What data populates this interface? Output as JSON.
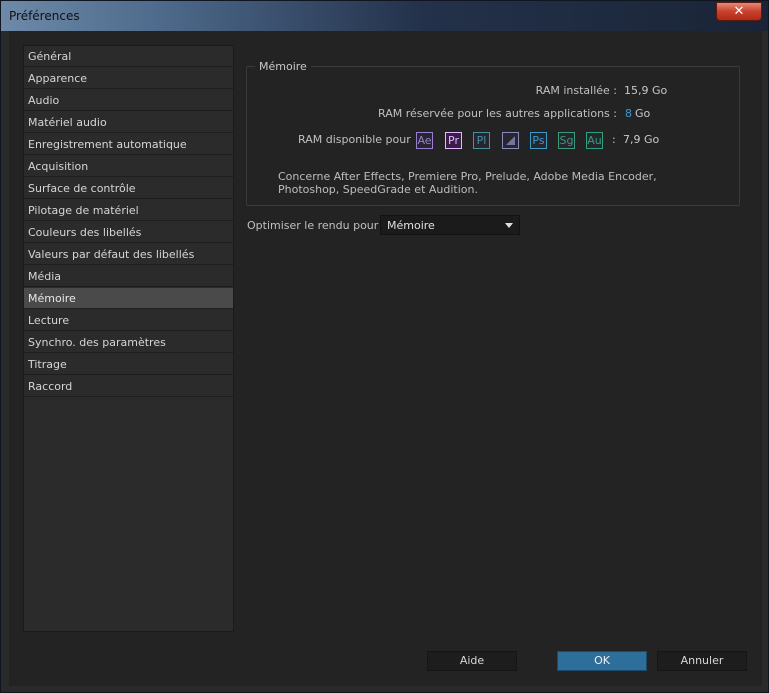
{
  "window": {
    "title": "Préférences",
    "close_glyph": "✕"
  },
  "sidebar": {
    "items": [
      {
        "label": "Général"
      },
      {
        "label": "Apparence"
      },
      {
        "label": "Audio"
      },
      {
        "label": "Matériel audio"
      },
      {
        "label": "Enregistrement automatique"
      },
      {
        "label": "Acquisition"
      },
      {
        "label": "Surface de contrôle"
      },
      {
        "label": "Pilotage de matériel"
      },
      {
        "label": "Couleurs des libellés"
      },
      {
        "label": "Valeurs par défaut des libellés"
      },
      {
        "label": "Média"
      },
      {
        "label": "Mémoire"
      },
      {
        "label": "Lecture"
      },
      {
        "label": "Synchro. des paramètres"
      },
      {
        "label": "Titrage"
      },
      {
        "label": "Raccord"
      }
    ],
    "selected": "Mémoire"
  },
  "memory": {
    "group_title": "Mémoire",
    "ram_installed_label": "RAM installée :",
    "ram_installed_value": "15,9 Go",
    "ram_reserved_label": "RAM réservée pour les autres applications :",
    "ram_reserved_value": "8",
    "ram_reserved_unit": "Go",
    "ram_available_label": "RAM disponible pour",
    "ram_available_sep": ":",
    "ram_available_value": "7,9 Go",
    "apps": [
      {
        "abbr": "Ae",
        "icon": "after-effects-icon",
        "color": "#9a7fd0"
      },
      {
        "abbr": "Pr",
        "icon": "premiere-pro-icon",
        "color": "#e6b6ff"
      },
      {
        "abbr": "Pl",
        "icon": "prelude-icon",
        "color": "#4b8ea0"
      },
      {
        "abbr": "",
        "icon": "media-encoder-icon",
        "color": "#8a8ab8"
      },
      {
        "abbr": "Ps",
        "icon": "photoshop-icon",
        "color": "#3a9ac8"
      },
      {
        "abbr": "Sg",
        "icon": "speedgrade-icon",
        "color": "#3a9a7a"
      },
      {
        "abbr": "Au",
        "icon": "audition-icon",
        "color": "#2fa07a"
      }
    ],
    "note": "Concerne After Effects, Premiere Pro, Prelude, Adobe Media Encoder, Photoshop, SpeedGrade et Audition."
  },
  "optimize": {
    "label": "Optimiser le rendu pour :",
    "value": "Mémoire"
  },
  "buttons": {
    "help": "Aide",
    "ok": "OK",
    "cancel": "Annuler"
  },
  "colors": {
    "accent": "#2e6e9a",
    "link_value": "#3a9ad9"
  }
}
